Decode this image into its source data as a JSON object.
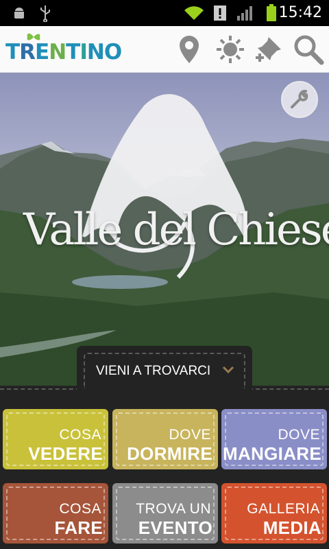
{
  "status_bar": {
    "time": "15:42",
    "icons": [
      "android-debug-icon",
      "usb-icon",
      "wifi-icon",
      "alert-icon",
      "signal-icon",
      "battery-icon"
    ]
  },
  "app_bar": {
    "logo_text": "TRENTINO",
    "actions": [
      "location-pin-icon",
      "sun-icon",
      "pin-add-icon",
      "search-icon"
    ]
  },
  "hero": {
    "title": "Valle del Chiese",
    "dropdown_label": "VIENI A TROVARCI"
  },
  "tiles": [
    {
      "line1": "COSA",
      "line2": "VEDERE",
      "color": "#c9c13a"
    },
    {
      "line1": "DOVE",
      "line2": "DORMIRE",
      "color": "#c8b45c"
    },
    {
      "line1": "DOVE",
      "line2": "MANGIARE",
      "color": "#8a8ec7"
    },
    {
      "line1": "COSA",
      "line2": "FARE",
      "color": "#a6553a"
    },
    {
      "line1": "TROVA UN",
      "line2": "EVENTO",
      "color": "#8c8c8c"
    },
    {
      "line1": "GALLERIA",
      "line2": "MEDIA",
      "color": "#d4532e"
    }
  ]
}
